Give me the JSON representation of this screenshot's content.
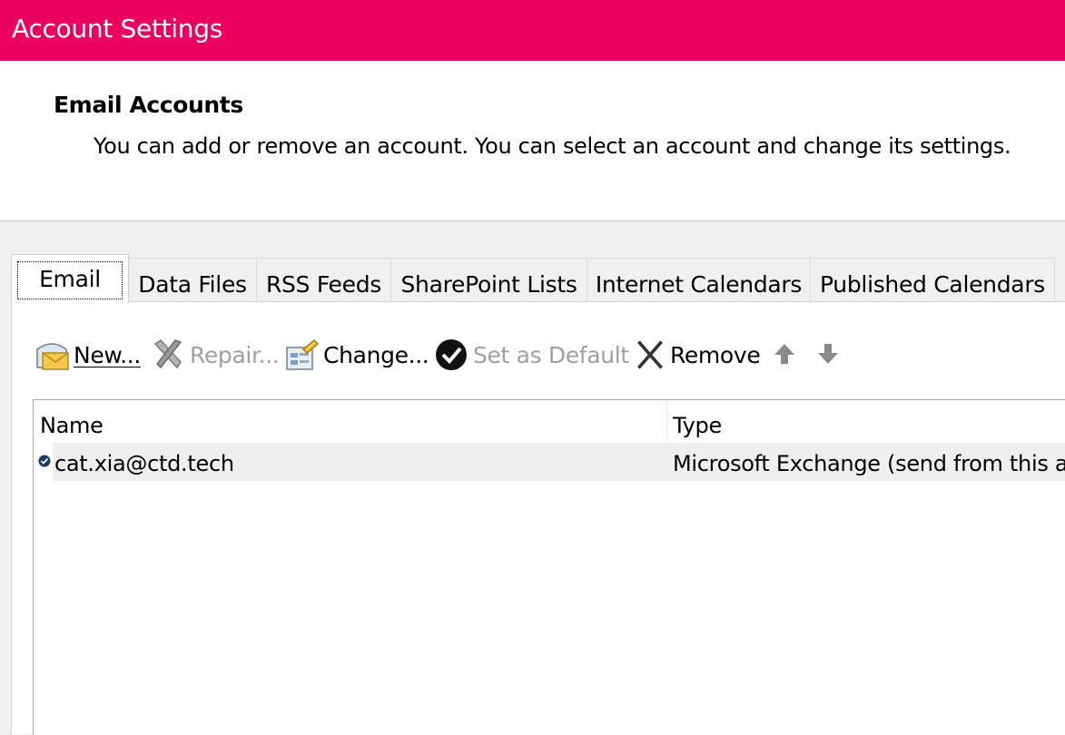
{
  "window": {
    "title": "Account Settings"
  },
  "header": {
    "heading": "Email Accounts",
    "description": "You can add or remove an account. You can select an account and change its settings."
  },
  "tabs": [
    {
      "label": "Email",
      "active": true
    },
    {
      "label": "Data Files"
    },
    {
      "label": "RSS Feeds"
    },
    {
      "label": "SharePoint Lists"
    },
    {
      "label": "Internet Calendars"
    },
    {
      "label": "Published Calendars"
    }
  ],
  "toolbar": {
    "new": {
      "label": "New...",
      "icon": "new-mail-icon"
    },
    "repair": {
      "label": "Repair...",
      "icon": "repair-tools-icon",
      "disabled": true
    },
    "change": {
      "label": "Change...",
      "icon": "change-settings-icon"
    },
    "set_default": {
      "label": "Set as Default",
      "icon": "checkmark-circle-icon",
      "disabled": true
    },
    "remove": {
      "label": "Remove",
      "icon": "remove-x-icon"
    },
    "move_up": {
      "icon": "arrow-up-icon"
    },
    "move_down": {
      "icon": "arrow-down-icon"
    }
  },
  "list": {
    "columns": {
      "name": "Name",
      "type": "Type"
    },
    "rows": [
      {
        "name": "cat.xia@ctd.tech",
        "type": "Microsoft Exchange (send from this a",
        "is_default": true
      }
    ]
  },
  "colors": {
    "titlebar": "#eb0060",
    "window_bg": "#f0f0f0",
    "selected_row": "#efefef"
  }
}
